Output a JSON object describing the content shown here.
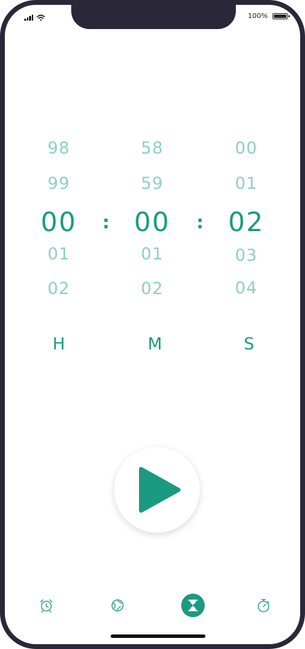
{
  "status_bar": {
    "battery_percent": "100%",
    "battery_level": 1.0
  },
  "picker": {
    "hours": {
      "above": [
        "98",
        "99"
      ],
      "selected": "00",
      "below": [
        "01",
        "02"
      ],
      "unit": "H"
    },
    "minutes": {
      "above": [
        "58",
        "59"
      ],
      "selected": "00",
      "below": [
        "01",
        "02"
      ],
      "unit": "M"
    },
    "seconds": {
      "above": [
        "00",
        "01"
      ],
      "selected": "02",
      "below": [
        "03",
        "04"
      ],
      "unit": "S"
    },
    "separator": ":"
  },
  "tabs": [
    {
      "icon": "alarm-clock-icon",
      "active": false
    },
    {
      "icon": "world-clock-icon",
      "active": false
    },
    {
      "icon": "hourglass-icon",
      "active": true
    },
    {
      "icon": "stopwatch-icon",
      "active": false
    }
  ],
  "colors": {
    "accent": "#1a9a80",
    "muted": "#8fd0bd",
    "frame": "#2a2838"
  }
}
